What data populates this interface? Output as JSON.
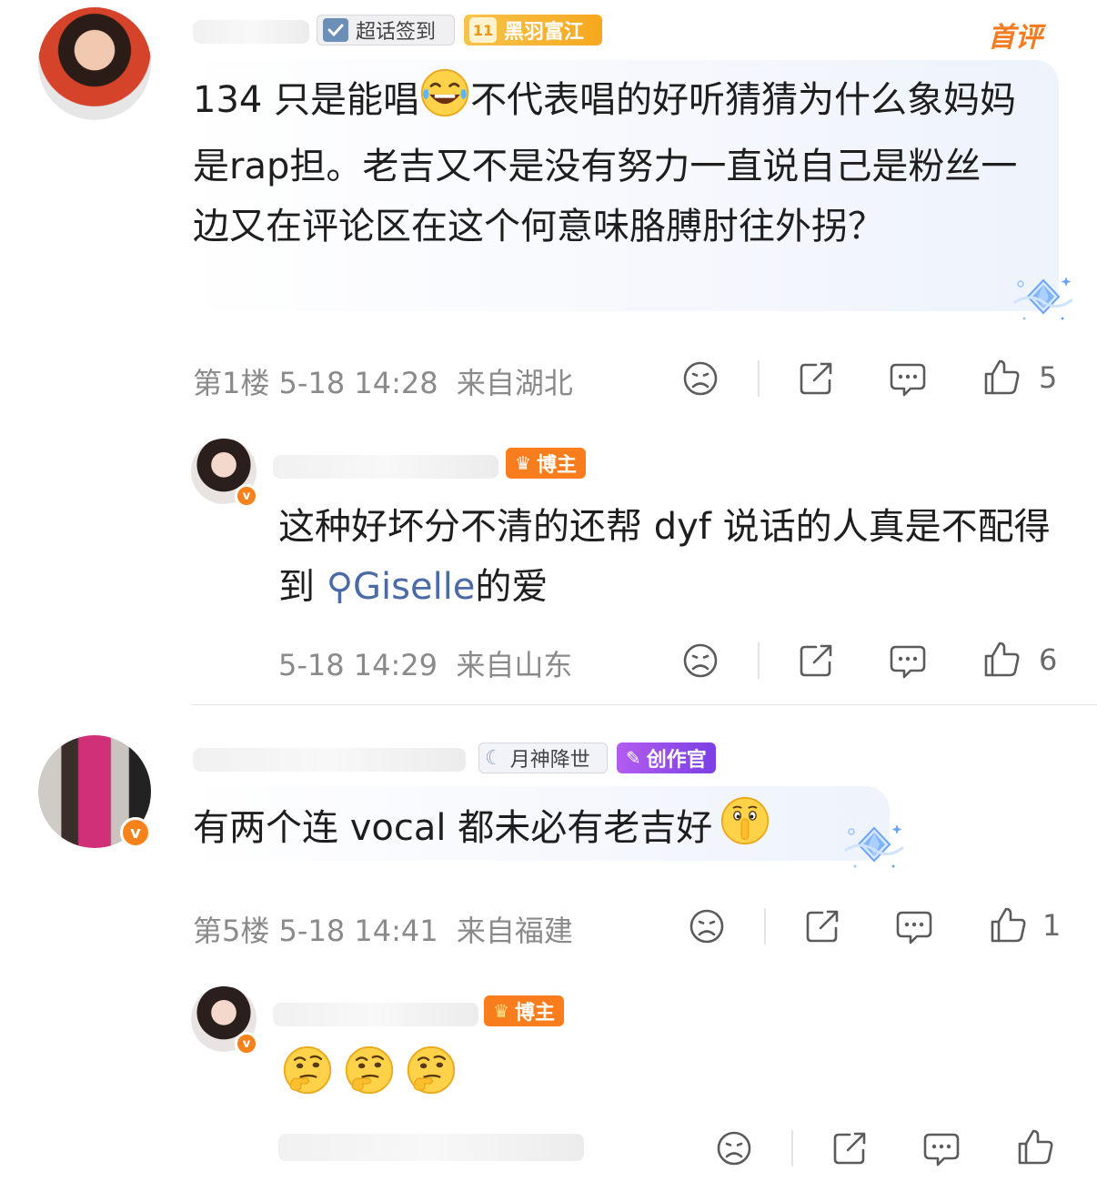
{
  "comments": [
    {
      "badges": {
        "checkin": "超话签到",
        "level": "11",
        "group": "黑羽富江"
      },
      "first_label": "首评",
      "text_a": "134 只是能唱",
      "text_b": "不代表唱的好听猜猜为什么象妈妈是rap担。老吉又不是没有努力一直说自己是粉丝一边又在评论区在这个何意味胳膊肘往外拐？",
      "emoji": "laughing-crying-emoji",
      "floor": "第1楼",
      "time": "5-18 14:28",
      "location": "来自湖北",
      "likes": "5"
    },
    {
      "badge": "博主",
      "text_a": "这种好坏分不清的还帮 dyf 说话的人真是不配得到",
      "link": "Giselle",
      "text_b": "的爱",
      "time": "5-18 14:29",
      "location": "来自山东",
      "likes": "6"
    },
    {
      "badges": {
        "title": "月神降世",
        "creator": "创作官"
      },
      "text": "有两个连 vocal 都未必有老吉好",
      "emoji": "shushing-face-emoji",
      "floor": "第5楼",
      "time": "5-18 14:41",
      "location": "来自福建",
      "likes": "1"
    },
    {
      "badge": "博主",
      "emojis": [
        "thinking-face-emoji",
        "thinking-face-emoji",
        "thinking-face-emoji"
      ]
    }
  ],
  "colors": {
    "verified": "#f7821b",
    "first": "#f47b20",
    "link": "#4a6aa8",
    "meta": "#8a8a8a"
  }
}
